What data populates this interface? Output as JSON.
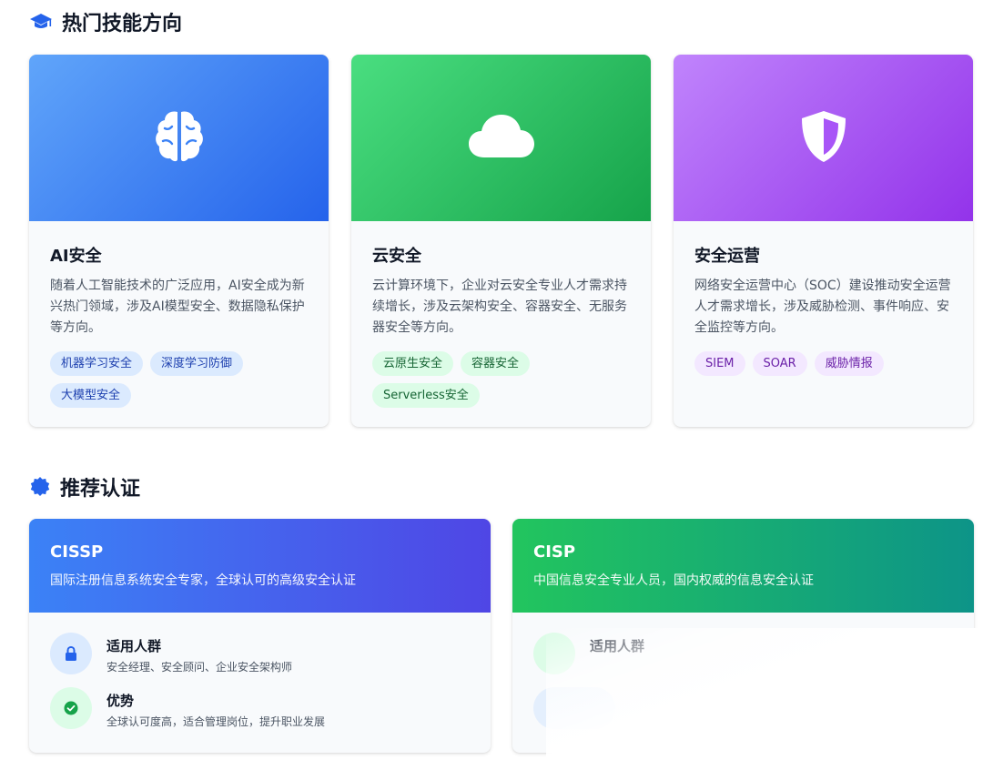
{
  "skills_section": {
    "title": "热门技能方向",
    "icon": "graduation-cap-icon"
  },
  "skills": [
    {
      "icon": "brain-icon",
      "title": "AI安全",
      "desc": "随着人工智能技术的广泛应用，AI安全成为新兴热门领域，涉及AI模型安全、数据隐私保护等方向。",
      "tags": [
        "机器学习安全",
        "深度学习防御",
        "大模型安全"
      ]
    },
    {
      "icon": "cloud-icon",
      "title": "云安全",
      "desc": "云计算环境下，企业对云安全专业人才需求持续增长，涉及云架构安全、容器安全、无服务器安全等方向。",
      "tags": [
        "云原生安全",
        "容器安全",
        "Serverless安全"
      ]
    },
    {
      "icon": "shield-icon",
      "title": "安全运营",
      "desc": "网络安全运营中心（SOC）建设推动安全运营人才需求增长，涉及威胁检测、事件响应、安全监控等方向。",
      "tags": [
        "SIEM",
        "SOAR",
        "威胁情报"
      ]
    }
  ],
  "cert_section": {
    "title": "推荐认证",
    "icon": "certificate-icon"
  },
  "certs": [
    {
      "name": "CISSP",
      "subtitle": "国际注册信息系统安全专家，全球认可的高级安全认证",
      "rows": [
        {
          "icon": "lock-icon",
          "title": "适用人群",
          "text": "安全经理、安全顾问、企业安全架构师"
        },
        {
          "icon": "check-circle-icon",
          "title": "优势",
          "text": "全球认可度高，适合管理岗位，提升职业发展"
        }
      ]
    },
    {
      "name": "CISP",
      "subtitle": "中国信息安全专业人员，国内权威的信息安全认证",
      "rows": [
        {
          "icon": "lock-icon",
          "title": "适用人群",
          "text": ""
        }
      ]
    }
  ],
  "colors": {
    "blue_start": "#60a5fa",
    "blue_end": "#2563eb",
    "green_start": "#4ade80",
    "green_end": "#16a34a",
    "purple_start": "#c084fc",
    "purple_end": "#9333ea",
    "section_icon": "#2563eb"
  }
}
